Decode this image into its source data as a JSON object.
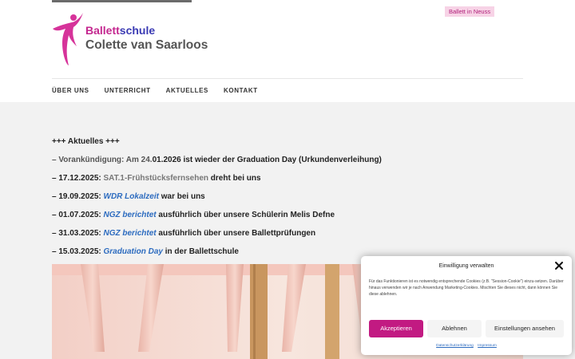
{
  "header": {
    "logo": {
      "line1_part1": "Ballett",
      "line1_part2": "schule",
      "line2": "Colette van Saarloos"
    },
    "tagline": "Ballett in Neuss"
  },
  "nav": {
    "items": [
      {
        "label": "ÜBER UNS"
      },
      {
        "label": "UNTERRICHT"
      },
      {
        "label": "AKTUELLES"
      },
      {
        "label": "KONTAKT"
      }
    ]
  },
  "news": {
    "heading": "+++ Aktuelles +++",
    "items": [
      {
        "prefix": "– Vorankündigung: Am 24.",
        "date": "01.2026",
        "text": " ist wieder der Graduation Day (Urkundenverleihung)"
      },
      {
        "prefix": "– 17.12.2025: ",
        "link": "SAT.1-Frühstücksfernsehen",
        "text": " dreht bei uns"
      },
      {
        "prefix": "– 19.09.2025: ",
        "link": "WDR Lokalzeit",
        "text": " war bei uns"
      },
      {
        "prefix": "– 01.07.2025: ",
        "link": "NGZ berichtet",
        "text": " ausführlich über unsere Schülerin Melis Defne"
      },
      {
        "prefix": "– 31.03.2025: ",
        "link": "NGZ berichtet",
        "text": " ausführlich über unsere Ballettprüfungen"
      },
      {
        "prefix": "– 15.03.2025: ",
        "link": "Graduation Day",
        "text": " in der Ballettschule"
      }
    ]
  },
  "cookie": {
    "title": "Einwilligung verwalten",
    "body": "Für das Funktionieren ist es notwendig entsprechende Cookies (z.B. \"Session-Cookie\") einzu-setzen. Darüber hinaus verwenden wir je nach Anwendung Marketing-Cookies. Mischten Sie dieses nicht, dann können Sie diese ablehnen.",
    "accept_label": "Akzeptieren",
    "deny_label": "Ablehnen",
    "settings_label": "Einstellungen ansehen",
    "link_privacy": "Datenschutzerklärung",
    "link_imprint": "Impressum"
  },
  "colors": {
    "brand_pink": "#c21a82",
    "link_blue": "#2c6bbf",
    "brand_blue": "#3a3ab3"
  },
  "icons": {
    "logo": "ballerina-logo-icon",
    "close": "close-icon"
  }
}
